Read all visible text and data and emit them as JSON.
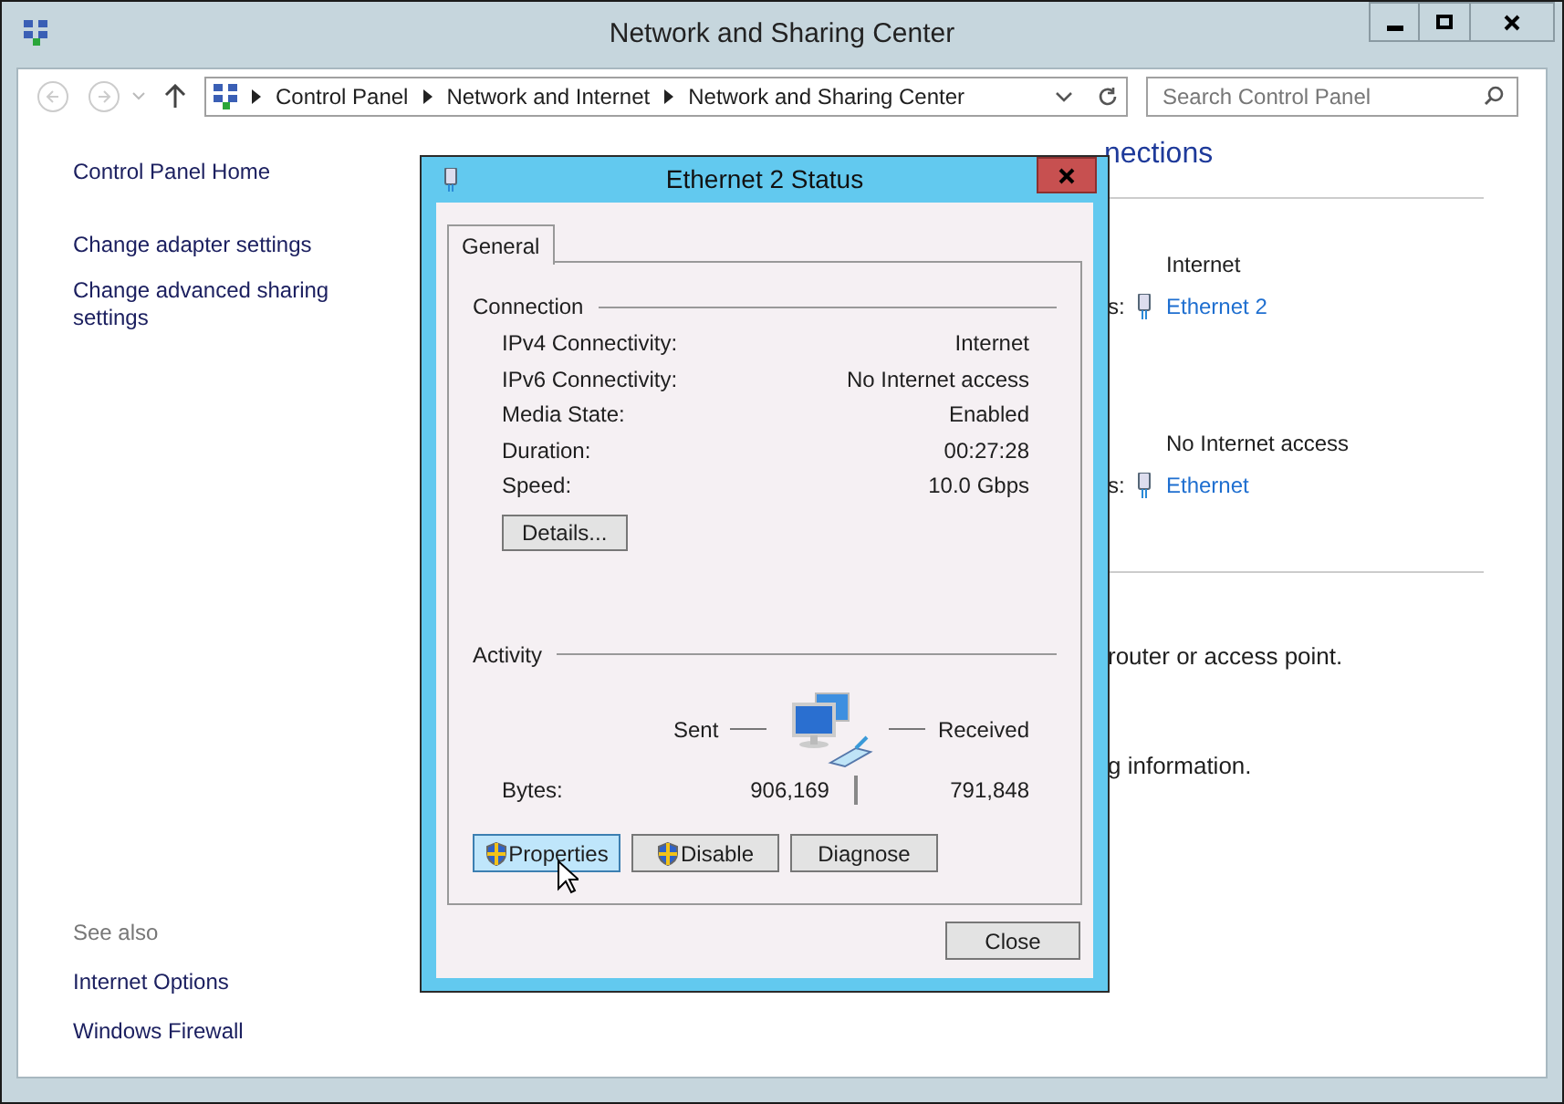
{
  "window": {
    "title": "Network and Sharing Center"
  },
  "nav": {
    "breadcrumb": [
      "Control Panel",
      "Network and Internet",
      "Network and Sharing Center"
    ],
    "search": {
      "placeholder": "Search Control Panel"
    }
  },
  "sidebar": {
    "links": [
      "Control Panel Home",
      "Change adapter settings",
      "Change advanced sharing settings"
    ],
    "see_also": {
      "heading": "See also",
      "links": [
        "Internet Options",
        "Windows Firewall"
      ]
    }
  },
  "main": {
    "heading": "nections",
    "networks": [
      {
        "access": "Internet",
        "connections_label": "s:",
        "connection": "Ethernet 2"
      },
      {
        "access": "No Internet access",
        "connections_label": "s:",
        "connection": "Ethernet"
      }
    ],
    "text_fragments": [
      "router or access point.",
      "g information."
    ]
  },
  "dialog": {
    "title": "Ethernet 2 Status",
    "tabs": [
      {
        "label": "General",
        "selected": true
      }
    ],
    "connection": {
      "heading": "Connection",
      "rows": [
        {
          "label": "IPv4 Connectivity:",
          "value": "Internet"
        },
        {
          "label": "IPv6 Connectivity:",
          "value": "No Internet access"
        },
        {
          "label": "Media State:",
          "value": "Enabled"
        },
        {
          "label": "Duration:",
          "value": "00:27:28"
        },
        {
          "label": "Speed:",
          "value": "10.0 Gbps"
        }
      ]
    },
    "details_button": "Details...",
    "activity": {
      "heading": "Activity",
      "sent_label": "Sent",
      "received_label": "Received",
      "bytes_label": "Bytes:",
      "sent": "906,169",
      "received": "791,848"
    },
    "buttons": [
      {
        "label": "Properties",
        "shield": true,
        "hovered": true
      },
      {
        "label": "Disable",
        "shield": true,
        "hovered": false
      },
      {
        "label": "Diagnose",
        "shield": false,
        "hovered": false
      }
    ],
    "close_button": "Close"
  }
}
